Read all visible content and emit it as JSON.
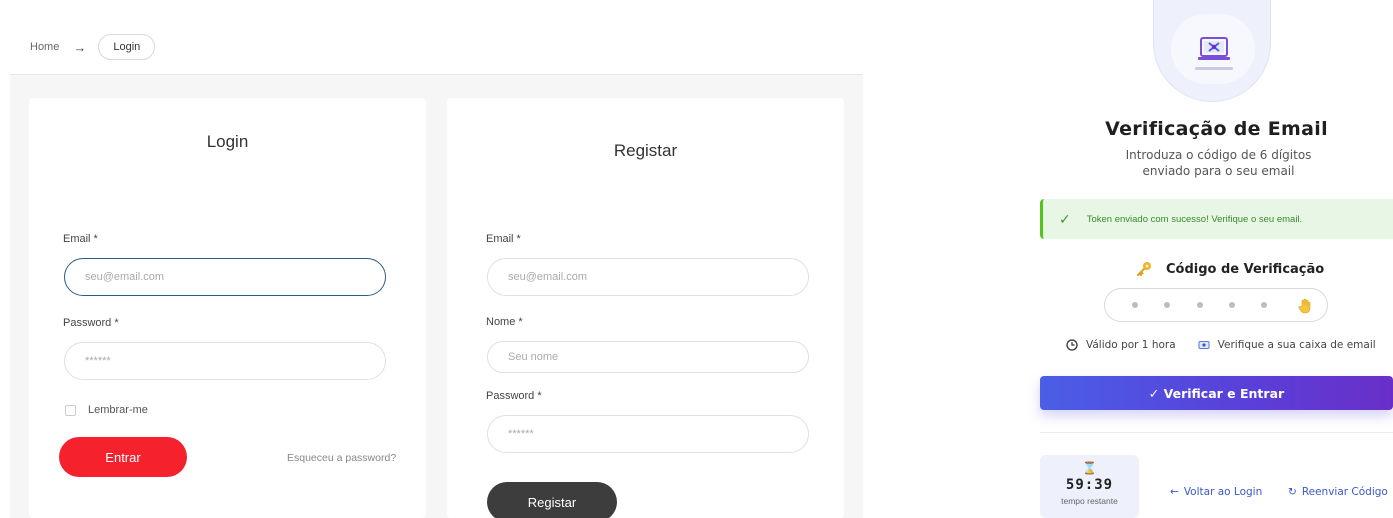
{
  "breadcrumb": {
    "home": "Home",
    "arrow": "→",
    "current": "Login"
  },
  "login": {
    "title": "Login",
    "email_label": "Email *",
    "email_placeholder": "seu@email.com",
    "password_label": "Password *",
    "password_placeholder": "******",
    "remember_label": "Lembrar-me",
    "submit_label": "Entrar",
    "forgot_label": "Esqueceu a password?"
  },
  "register": {
    "title": "Registar",
    "email_label": "Email *",
    "email_placeholder": "seu@email.com",
    "name_label": "Nome *",
    "name_placeholder": "Seu nome",
    "password_label": "Password *",
    "password_placeholder": "******",
    "submit_label": "Registar"
  },
  "verify": {
    "title": "Verificação de Email",
    "subtitle_line1": "Introduza o código de 6 dígitos",
    "subtitle_line2": "enviado para o seu email",
    "alert_check": "✓",
    "alert_text": "Token enviado com sucesso! Verifique o seu email.",
    "code_label": "Código de Verificação",
    "hint_valid": "Válido por 1 hora",
    "hint_inbox": "Verifique a sua caixa de email",
    "verify_button": "✓  Verificar e Entrar",
    "timer_icon": "⌛",
    "timer_value": "59:39",
    "timer_label": "tempo restante",
    "back_icon": "←",
    "back_label": "Voltar ao Login",
    "resend_icon": "↻",
    "resend_label": "Reenviar Código"
  },
  "colors": {
    "primary_red": "#f5222d",
    "dark_button": "#3d3d3d",
    "success_green": "#52c41a",
    "accent_blue": "#3a58c8",
    "gradient_start": "#4a5ee6",
    "gradient_end": "#6a2fc8"
  },
  "icons": {
    "key": "key-icon",
    "hand": "hand-icon",
    "clock": "clock-icon",
    "mail": "mail-icon",
    "hourglass": "hourglass-icon",
    "laptop": "laptop-logo-icon"
  }
}
